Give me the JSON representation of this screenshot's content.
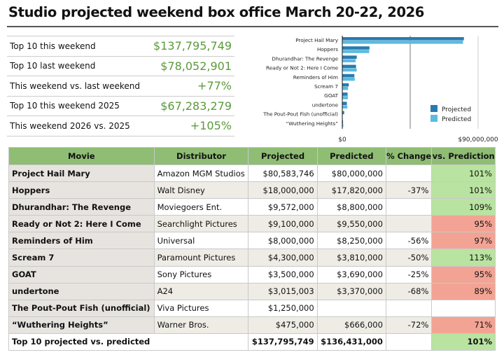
{
  "title": "Studio projected weekend box office March 20-22, 2026",
  "summary": [
    {
      "label": "Top 10 this weekend",
      "value": "$137,795,749"
    },
    {
      "label": "Top 10 last weekend",
      "value": "$78,052,901"
    },
    {
      "label": "This weekend vs. last weekend",
      "value": "+77%"
    },
    {
      "label": "Top 10 this weekend 2025",
      "value": "$67,283,279"
    },
    {
      "label": "This weekend 2026 vs. 2025",
      "value": "+105%"
    }
  ],
  "colors": {
    "projected": "#2a7ab0",
    "predicted": "#5bbbe0",
    "good": "#b9e3a0",
    "bad": "#f3a394",
    "header": "#8fbd74"
  },
  "chart_data": {
    "type": "bar",
    "orientation": "horizontal",
    "categories": [
      "Project Hail Mary",
      "Hoppers",
      "Dhurandhar: The Revenge",
      "Ready or Not 2: Here I Come",
      "Reminders of Him",
      "Scream 7",
      "GOAT",
      "undertone",
      "The Pout-Pout Fish (unofficial)",
      "“Wuthering Heights”"
    ],
    "series": [
      {
        "name": "Projected",
        "values": [
          80583746,
          18000000,
          9572000,
          9100000,
          8000000,
          4300000,
          3500000,
          3015003,
          1250000,
          475000
        ]
      },
      {
        "name": "Predicted",
        "values": [
          80000000,
          17820000,
          8800000,
          9550000,
          8250000,
          3810000,
          3690000,
          3370000,
          null,
          666000
        ]
      }
    ],
    "xlim": [
      0,
      90000000
    ],
    "xticks": [
      "$0",
      "$90,000,000"
    ],
    "legend": "bottom-right",
    "grid": true
  },
  "table": {
    "headers": [
      "Movie",
      "Distributor",
      "Projected",
      "Predicted",
      "% Change",
      "vs. Prediction"
    ],
    "rows": [
      {
        "movie": "Project Hail Mary",
        "dist": "Amazon MGM Studios",
        "proj": "$80,583,746",
        "pred": "$80,000,000",
        "chg": "",
        "vs": "101%",
        "status": "g"
      },
      {
        "movie": "Hoppers",
        "dist": "Walt Disney",
        "proj": "$18,000,000",
        "pred": "$17,820,000",
        "chg": "-37%",
        "vs": "101%",
        "status": "g"
      },
      {
        "movie": "Dhurandhar: The Revenge",
        "dist": "Moviegoers Ent.",
        "proj": "$9,572,000",
        "pred": "$8,800,000",
        "chg": "",
        "vs": "109%",
        "status": "g"
      },
      {
        "movie": "Ready or Not 2: Here I Come",
        "dist": "Searchlight Pictures",
        "proj": "$9,100,000",
        "pred": "$9,550,000",
        "chg": "",
        "vs": "95%",
        "status": "r"
      },
      {
        "movie": "Reminders of Him",
        "dist": "Universal",
        "proj": "$8,000,000",
        "pred": "$8,250,000",
        "chg": "-56%",
        "vs": "97%",
        "status": "r"
      },
      {
        "movie": "Scream 7",
        "dist": "Paramount Pictures",
        "proj": "$4,300,000",
        "pred": "$3,810,000",
        "chg": "-50%",
        "vs": "113%",
        "status": "g"
      },
      {
        "movie": "GOAT",
        "dist": "Sony Pictures",
        "proj": "$3,500,000",
        "pred": "$3,690,000",
        "chg": "-25%",
        "vs": "95%",
        "status": "r"
      },
      {
        "movie": "undertone",
        "dist": "A24",
        "proj": "$3,015,003",
        "pred": "$3,370,000",
        "chg": "-68%",
        "vs": "89%",
        "status": "r"
      },
      {
        "movie": "The Pout-Pout Fish (unofficial)",
        "dist": "Viva Pictures",
        "proj": "$1,250,000",
        "pred": "",
        "chg": "",
        "vs": "",
        "status": ""
      },
      {
        "movie": "“Wuthering Heights”",
        "dist": "Warner Bros.",
        "proj": "$475,000",
        "pred": "$666,000",
        "chg": "-72%",
        "vs": "71%",
        "status": "r"
      }
    ],
    "total": {
      "label": "Top 10 projected vs. predicted",
      "proj": "$137,795,749",
      "pred": "$136,431,000",
      "vs": "101%"
    }
  }
}
